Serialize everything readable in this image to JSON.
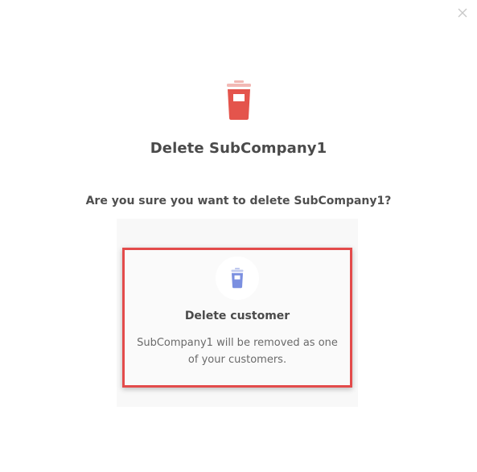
{
  "dialog": {
    "title": "Delete SubCompany1",
    "question": "Are you sure you want to delete SubCompany1?",
    "close_icon": "close-icon",
    "hero_icon": "trash-icon",
    "accent_color": "#e4544c"
  },
  "option": {
    "title": "Delete customer",
    "description": "SubCompany1 will be removed as one of your customers.",
    "icon": "trash-icon",
    "icon_color": "#7b8fe0",
    "selected": true,
    "highlight_color": "#e34b4b"
  }
}
